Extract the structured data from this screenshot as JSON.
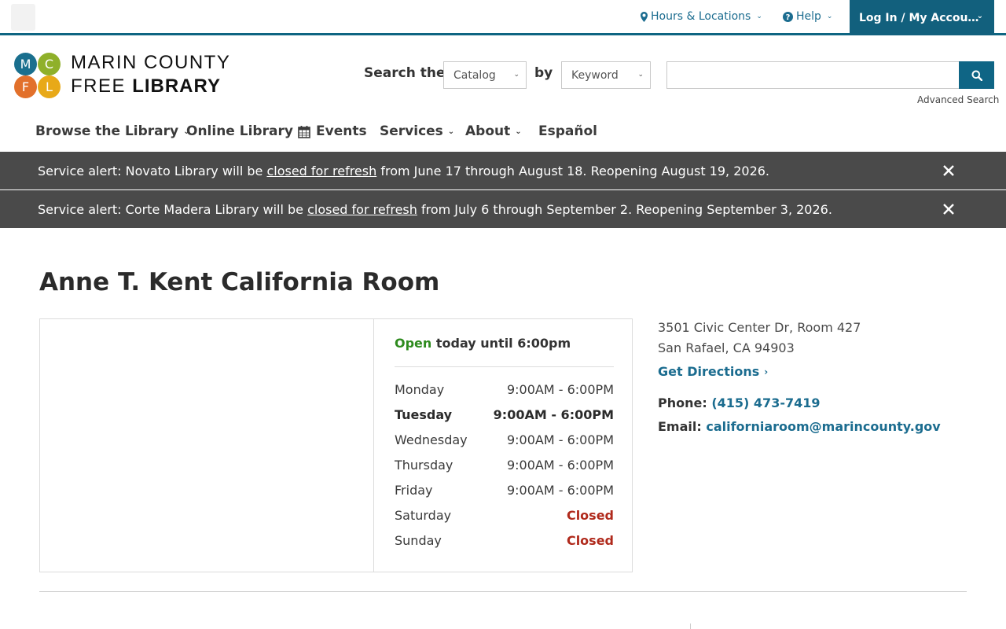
{
  "utility": {
    "hours_locations": "Hours & Locations",
    "help": "Help",
    "login": "Log In / My Accou…"
  },
  "logo": {
    "letters": [
      "M",
      "C",
      "F",
      "L"
    ],
    "line1": "MARIN COUNTY",
    "line2_a": "FREE",
    "line2_b": "LIBRARY",
    "colors": [
      "#1a6f8e",
      "#8fb02a",
      "#e2702b",
      "#e8a918"
    ]
  },
  "search": {
    "label": "Search the",
    "scope_value": "Catalog",
    "by_label": "by",
    "field_value": "Keyword",
    "query_value": "",
    "advanced": "Advanced Search"
  },
  "nav": {
    "browse": "Browse the Library",
    "online": "Online Library",
    "events": "Events",
    "services": "Services",
    "about": "About",
    "espanol": "Español"
  },
  "alerts": [
    {
      "prefix": "Service alert: Novato Library will be ",
      "link": "closed for refresh",
      "suffix": " from June 17 through August 18. Reopening August 19, 2026."
    },
    {
      "prefix": "Service alert: Corte Madera Library will be ",
      "link": "closed for refresh",
      "suffix": " from July 6 through September 2. Reopening September 3, 2026."
    }
  ],
  "page": {
    "title": "Anne T. Kent California Room"
  },
  "hours": {
    "status": "Open",
    "status_rest": " today until 6:00pm",
    "days": [
      {
        "day": "Monday",
        "time": "9:00AM - 6:00PM"
      },
      {
        "day": "Tuesday",
        "time": "9:00AM - 6:00PM"
      },
      {
        "day": "Wednesday",
        "time": "9:00AM - 6:00PM"
      },
      {
        "day": "Thursday",
        "time": "9:00AM - 6:00PM"
      },
      {
        "day": "Friday",
        "time": "9:00AM - 6:00PM"
      },
      {
        "day": "Saturday",
        "time": "Closed"
      },
      {
        "day": "Sunday",
        "time": "Closed"
      }
    ]
  },
  "location": {
    "address_line1": "3501 Civic Center Dr, Room 427",
    "address_line2": "San Rafael, CA 94903",
    "directions": "Get Directions",
    "phone_label": "Phone:",
    "phone": "(415) 473-7419",
    "email_label": "Email:",
    "email": "californiaroom@marincounty.gov"
  }
}
